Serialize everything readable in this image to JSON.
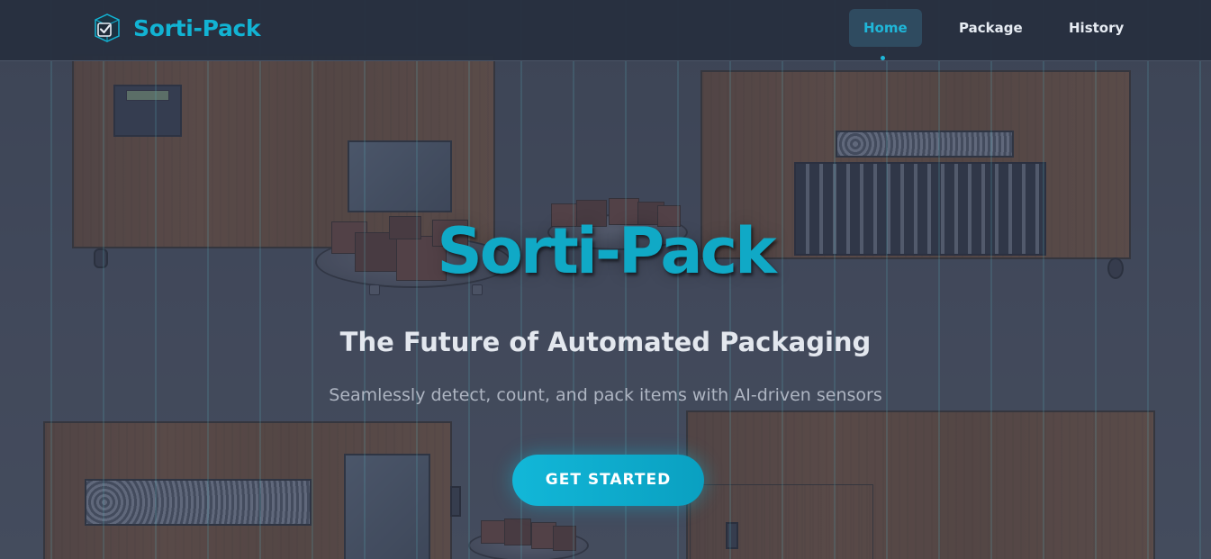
{
  "navbar": {
    "brand_name": "Sorti-Pack",
    "brand_icon": "checkbox-cube-icon",
    "items": [
      {
        "label": "Home",
        "active": true
      },
      {
        "label": "Package",
        "active": false
      },
      {
        "label": "History",
        "active": false
      }
    ]
  },
  "hero": {
    "title": "Sorti-Pack",
    "subtitle": "The Future of Automated Packaging",
    "description": "Seamlessly detect, count, and pack items with AI-driven sensors",
    "cta_label": "GET STARTED"
  },
  "colors": {
    "accent": "#12b3d3",
    "navbar_bg": "#28303f",
    "hero_overlay": "#3e4658",
    "cta_gradient_start": "#12b7d8",
    "cta_gradient_end": "#0aa0c1"
  }
}
